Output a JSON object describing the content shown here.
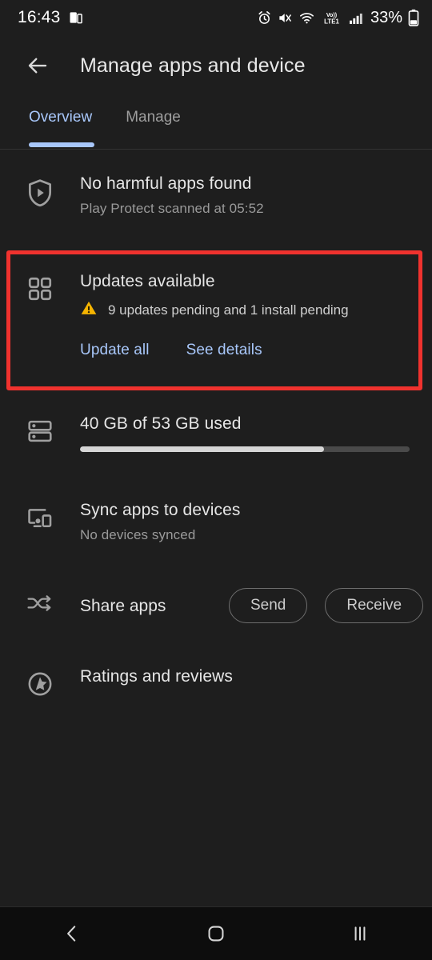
{
  "status_bar": {
    "time": "16:43",
    "battery_percent": "33%",
    "icons": [
      "multi-window-icon",
      "alarm-icon",
      "mute-icon",
      "wifi-icon",
      "volte-icon",
      "signal-icon",
      "battery-icon"
    ],
    "network_label": "Vo)) LTE1"
  },
  "app_bar": {
    "back_icon": "back-arrow-icon",
    "title": "Manage apps and device"
  },
  "tabs": {
    "items": [
      {
        "label": "Overview",
        "active": true
      },
      {
        "label": "Manage",
        "active": false
      }
    ]
  },
  "colors": {
    "accent_blue": "#a8c7fa",
    "highlight_red": "#f0322e",
    "warning_amber": "#f5b401",
    "background": "#1e1e1e"
  },
  "sections": {
    "play_protect": {
      "icon": "shield-play-icon",
      "title": "No harmful apps found",
      "subtitle": "Play Protect scanned at 05:52"
    },
    "updates": {
      "icon": "apps-grid-icon",
      "warning_icon": "warning-triangle-icon",
      "title": "Updates available",
      "subtitle": "9 updates pending and 1 install pending",
      "update_all_label": "Update all",
      "see_details_label": "See details",
      "highlighted": true
    },
    "storage": {
      "icon": "storage-icon",
      "title": "40 GB of 53 GB used",
      "used_gb": 40,
      "total_gb": 53,
      "progress_percent": 74
    },
    "sync": {
      "icon": "devices-icon",
      "title": "Sync apps to devices",
      "subtitle": "No devices synced"
    },
    "share_apps": {
      "icon": "share-swap-icon",
      "title": "Share apps",
      "send_label": "Send",
      "receive_label": "Receive"
    },
    "ratings": {
      "icon": "star-circle-icon",
      "title": "Ratings and reviews"
    }
  },
  "nav_bar": {
    "back_icon": "nav-back-icon",
    "home_icon": "nav-home-icon",
    "recents_icon": "nav-recents-icon"
  }
}
